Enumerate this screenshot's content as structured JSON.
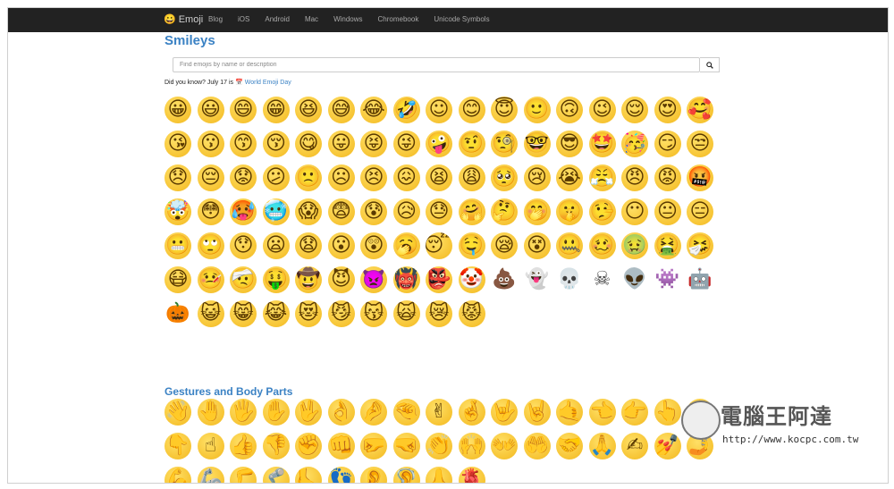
{
  "navbar": {
    "brand": "Emoji",
    "brand_icon": "😀",
    "links": [
      "Blog",
      "iOS",
      "Android",
      "Mac",
      "Windows",
      "Chromebook",
      "Unicode Symbols"
    ]
  },
  "smileys": {
    "title": "Smileys",
    "search_placeholder": "Find emojis by name or description",
    "did_you_know_prefix": "Did you know? July 17 is",
    "calendar_icon": "📅",
    "did_you_know_link": "World Emoji Day",
    "emojis": [
      "😀",
      "😃",
      "😄",
      "😁",
      "😆",
      "😅",
      "😂",
      "🤣",
      "☺",
      "😊",
      "😇",
      "🙂",
      "🙃",
      "😉",
      "😌",
      "😍",
      "🥰",
      "😘",
      "😗",
      "😙",
      "😚",
      "😋",
      "😛",
      "😝",
      "😜",
      "🤪",
      "🤨",
      "🧐",
      "🤓",
      "😎",
      "🤩",
      "🥳",
      "😏",
      "😒",
      "😞",
      "😔",
      "😟",
      "😕",
      "🙁",
      "☹",
      "😣",
      "😖",
      "😫",
      "😩",
      "🥺",
      "😢",
      "😭",
      "😤",
      "😠",
      "😡",
      "🤬",
      "🤯",
      "😳",
      "🥵",
      "🥶",
      "😱",
      "😨",
      "😰",
      "😥",
      "😓",
      "🤗",
      "🤔",
      "🤭",
      "🤫",
      "🤥",
      "😶",
      "😐",
      "😑",
      "😬",
      "🙄",
      "😯",
      "😦",
      "😧",
      "😮",
      "😲",
      "🥱",
      "😴",
      "🤤",
      "😪",
      "😵",
      "🤐",
      "🥴",
      "🤢",
      "🤮",
      "🤧",
      "😷",
      "🤒",
      "🤕",
      "🤑",
      "🤠",
      "😈",
      "👿",
      "👹",
      "👺",
      "🤡",
      "💩",
      "👻",
      "💀",
      "☠",
      "👽",
      "👾",
      "🤖",
      "🎃",
      "😺",
      "😸",
      "😹",
      "😻",
      "😼",
      "😽",
      "🙀",
      "😿",
      "😾"
    ]
  },
  "gestures": {
    "title": "Gestures and Body Parts",
    "emojis": [
      "👋",
      "🤚",
      "🖐",
      "✋",
      "🖖",
      "👌",
      "🤌",
      "🤏",
      "✌",
      "🤞",
      "🤟",
      "🤘",
      "🤙",
      "👈",
      "👉",
      "👆",
      "🖕",
      "👇",
      "☝",
      "👍",
      "👎",
      "✊",
      "👊",
      "🤛",
      "🤜",
      "👏",
      "🙌",
      "👐",
      "🤲",
      "🤝",
      "🙏",
      "✍",
      "💅",
      "🤳",
      "💪",
      "🦾",
      "🦵",
      "🦿",
      "🦶",
      "👣",
      "👂",
      "🦻",
      "👃",
      "🫀"
    ]
  },
  "watermark": {
    "title": "電腦王阿達",
    "url": "http://www.kocpc.com.tw"
  }
}
